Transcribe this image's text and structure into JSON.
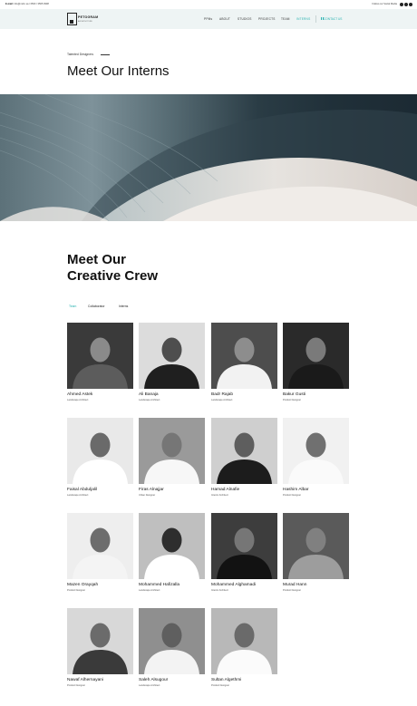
{
  "topbar": {
    "email_label": "E-mail:",
    "email_value": "info@m2m.sa / 0500 / 3565 0908",
    "social_label": "Follow our Social Media"
  },
  "navbar": {
    "logo_title": "PPEI",
    "logo_name": "PETOGRAM",
    "logo_tagline": "ARCHITECTURE",
    "items": [
      "PPMs",
      "ABOUT",
      "STUDIOS",
      "PROJECTS",
      "TEAM",
      "INTERNS"
    ],
    "active_item": "INTERNS",
    "contact_label": "CONTACT US",
    "accent_color": "#2bb3b1"
  },
  "intro": {
    "eyebrow": "Talented Designers",
    "title": "Meet Our Interns"
  },
  "crew": {
    "title_line1": "Meet Our",
    "title_line2": "Creative Crew",
    "tabs": [
      "Team",
      "Collaborator",
      "Interns"
    ],
    "active_tab": "Team",
    "members": [
      {
        "name": "Ahmed Astek",
        "role": "Landscape Architect"
      },
      {
        "name": "Ali Banaja",
        "role": "Landscape Architect"
      },
      {
        "name": "Badr Rajab",
        "role": "Landscape Architect"
      },
      {
        "name": "Bakur Gusti",
        "role": "Product Designer"
      },
      {
        "name": "Faisal Abduljalil",
        "role": "Landscape Architect"
      },
      {
        "name": "Firas Alnajjar",
        "role": "Urban Designer"
      },
      {
        "name": "Hamad Alnafie",
        "role": "Interior Architect"
      },
      {
        "name": "Hashim Albar",
        "role": "Product Designer"
      },
      {
        "name": "Mazen Orayqah",
        "role": "Product Designer"
      },
      {
        "name": "Mohammed Hafizalla",
        "role": "Landscape Architect"
      },
      {
        "name": "Mohammed Alghamadi",
        "role": "Interior Architect"
      },
      {
        "name": "Murad Hann",
        "role": "Product Designer"
      },
      {
        "name": "Nawaf Alhernayani",
        "role": "Product Designer"
      },
      {
        "name": "Saleh Alsugour",
        "role": "Landscape Architect"
      },
      {
        "name": "Sultan Algethmi",
        "role": "Product Designer"
      }
    ]
  }
}
